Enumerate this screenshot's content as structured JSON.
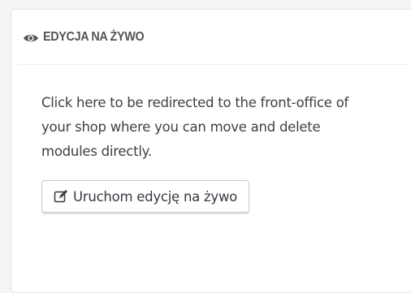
{
  "panel": {
    "title": "EDYCJA NA ŻYWO",
    "title_icon": "eye-icon",
    "description": "Click here to be redirected to the front-office of your shop where you can move and delete modules directly.",
    "button": {
      "label": "Uruchom edycję na żywo",
      "icon": "edit-icon"
    }
  }
}
